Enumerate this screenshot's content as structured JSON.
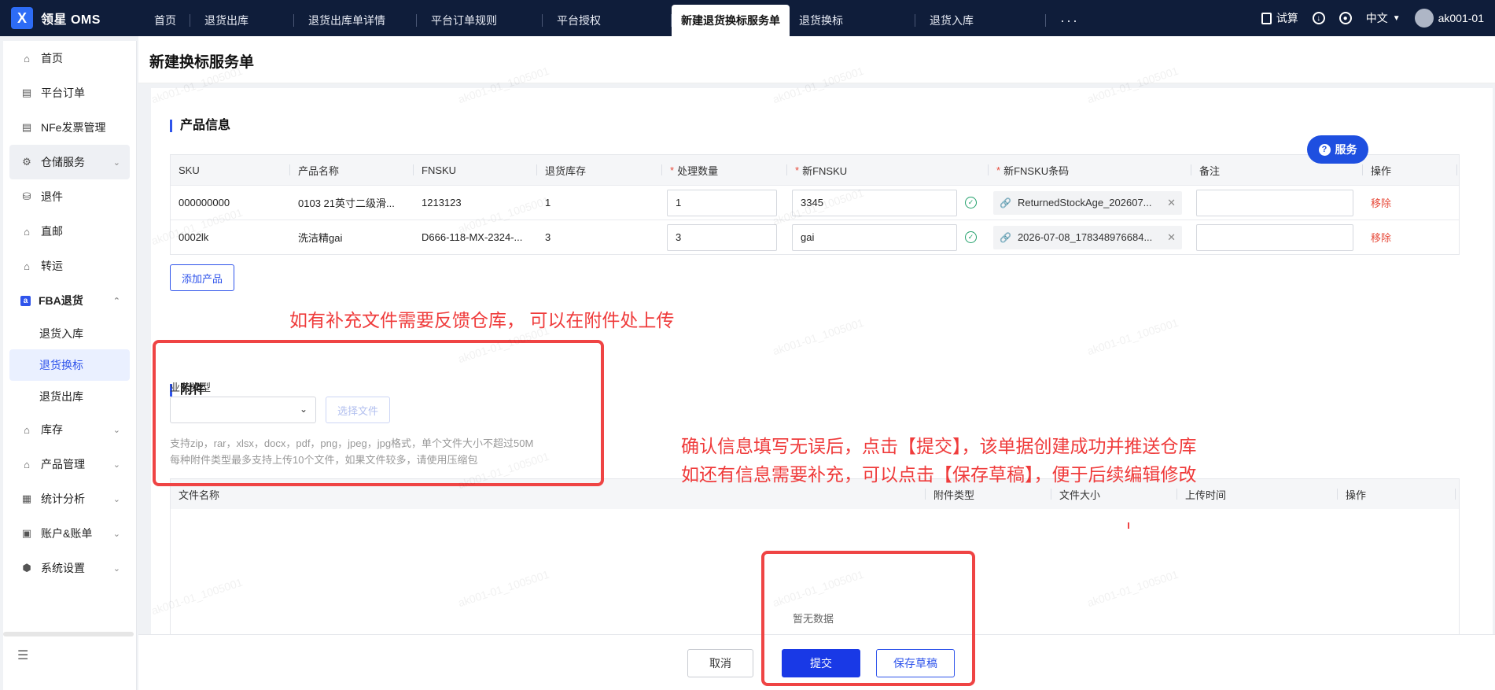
{
  "app": {
    "logo_letter": "X",
    "name": "领星 OMS"
  },
  "tabs": [
    {
      "label": "首页"
    },
    {
      "label": "退货出库"
    },
    {
      "label": "退货出库单详情"
    },
    {
      "label": "平台订单规则"
    },
    {
      "label": "平台授权"
    },
    {
      "label": "新建退货换标服务单",
      "active": true
    },
    {
      "label": "退货换标"
    },
    {
      "label": "退货入库"
    }
  ],
  "tabs_more": "···",
  "topbar": {
    "trial": "试算",
    "language": "中文",
    "user": "ak001-01"
  },
  "sidebar": {
    "items": [
      {
        "label": "首页",
        "icon": "home-icon"
      },
      {
        "label": "平台订单",
        "icon": "clipboard-icon"
      },
      {
        "label": "NFe发票管理",
        "icon": "invoice-icon"
      },
      {
        "label": "仓储服务",
        "icon": "warehouse-icon"
      },
      {
        "label": "退件",
        "icon": "return-icon"
      },
      {
        "label": "直邮",
        "icon": "mail-icon"
      },
      {
        "label": "转运",
        "icon": "transfer-icon"
      },
      {
        "label": "FBA退货",
        "icon": "amazon-icon"
      }
    ],
    "fba_sub": [
      {
        "label": "退货入库"
      },
      {
        "label": "退货换标"
      },
      {
        "label": "退货出库"
      }
    ],
    "items2": [
      {
        "label": "库存",
        "icon": "inventory-icon"
      },
      {
        "label": "产品管理",
        "icon": "product-icon"
      },
      {
        "label": "统计分析",
        "icon": "chart-icon"
      },
      {
        "label": "账户&账单",
        "icon": "wallet-icon"
      },
      {
        "label": "系统设置",
        "icon": "settings-icon"
      }
    ]
  },
  "page": {
    "title": "新建换标服务单",
    "service_button": "服务"
  },
  "product_section": {
    "title": "产品信息",
    "columns": [
      "SKU",
      "产品名称",
      "FNSKU",
      "退货库存",
      "处理数量",
      "新FNSKU",
      "新FNSKU条码",
      "备注",
      "操作"
    ],
    "rows": [
      {
        "sku": "000000000",
        "name": "0103 21英寸二级滑...",
        "fnsku": "1213123",
        "stock": "1",
        "qty": "1",
        "new_fnsku": "3345",
        "barcode": "ReturnedStockAge_202607...",
        "remark": "",
        "action": "移除"
      },
      {
        "sku": "0002lk",
        "name": "洗洁精gai",
        "fnsku": "D666-118-MX-2324-...",
        "stock": "3",
        "qty": "3",
        "new_fnsku": "gai",
        "barcode": "2026-07-08_178348976684...",
        "remark": "",
        "action": "移除"
      }
    ],
    "add_button": "添加产品"
  },
  "attachment_section": {
    "title": "附件",
    "type_label": "业务类型",
    "type_value": "",
    "choose_file": "选择文件",
    "hint_line1": "支持zip，rar，xlsx，docx，pdf，png，jpeg，jpg格式，单个文件大小不超过50M",
    "hint_line2": "每种附件类型最多支持上传10个文件，如果文件较多，请使用压缩包",
    "columns": [
      "文件名称",
      "附件类型",
      "文件大小",
      "上传时间",
      "操作"
    ],
    "empty": "暂无数据"
  },
  "footer": {
    "cancel": "取消",
    "submit": "提交",
    "save_draft": "保存草稿"
  },
  "annotations": {
    "attachment_note": "如有补充文件需要反馈仓库， 可以在附件处上传",
    "submit_note_1": "确认信息填写无误后，点击【提交】，该单据创建成功并推送仓库",
    "submit_note_2": "如还有信息需要补充，可以点击【保存草稿】，便于后续编辑修改"
  },
  "watermark": "ak001-01_1005001",
  "colors": {
    "topbar": "#0f1d3a",
    "primary": "#1939e6",
    "annotation": "#ef4444",
    "danger": "#e74c3c",
    "success": "#22a06b"
  }
}
